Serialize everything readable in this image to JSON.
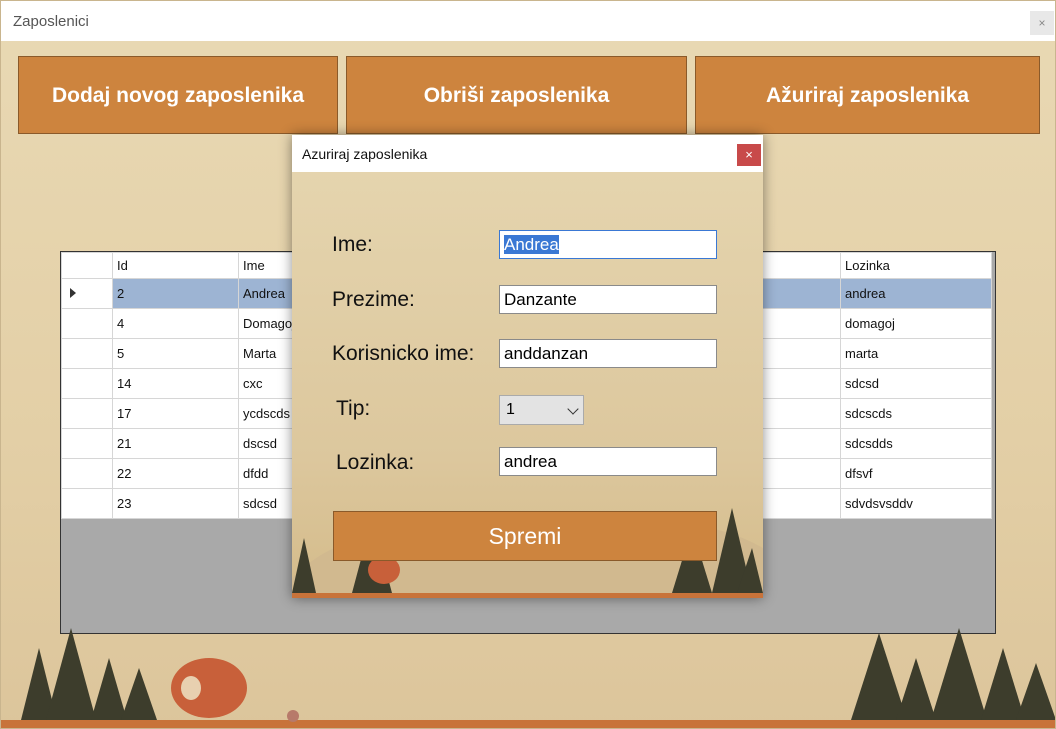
{
  "main_window": {
    "title": "Zaposlenici",
    "close_glyph": "×"
  },
  "toolbar": {
    "add_label": "Dodaj novog zaposlenika",
    "delete_label": "Obriši zaposlenika",
    "update_label": "Ažuriraj zaposlenika"
  },
  "grid": {
    "columns": [
      "Id",
      "Ime",
      "Lozinka"
    ],
    "rows": [
      {
        "id": "2",
        "ime": "Andrea",
        "lozinka": "andrea"
      },
      {
        "id": "4",
        "ime": "Domagoj",
        "lozinka": "domagoj"
      },
      {
        "id": "5",
        "ime": "Marta",
        "lozinka": "marta"
      },
      {
        "id": "14",
        "ime": "cxc",
        "lozinka": "sdcsd"
      },
      {
        "id": "17",
        "ime": "ycdscds",
        "lozinka": "sdcscds"
      },
      {
        "id": "21",
        "ime": "dscsd",
        "lozinka": "sdcsdds"
      },
      {
        "id": "22",
        "ime": "dfdd",
        "lozinka": "dfsvf"
      },
      {
        "id": "23",
        "ime": "sdcsd",
        "lozinka": "sdvdsvsddv"
      }
    ],
    "selected_row": 0
  },
  "dialog": {
    "title": "Azuriraj zaposlenika",
    "close_glyph": "×",
    "labels": {
      "ime": "Ime:",
      "prezime": "Prezime:",
      "korisnicko_ime": "Korisnicko ime:",
      "tip": "Tip:",
      "lozinka": "Lozinka:"
    },
    "values": {
      "ime": "Andrea",
      "prezime": "Danzante",
      "korisnicko_ime": "anddanzan",
      "tip": "1",
      "lozinka": "andrea"
    },
    "save_label": "Spremi"
  },
  "colors": {
    "accent": "#cd843e",
    "selection": "#9db4d3",
    "close_red": "#c84a4a"
  }
}
